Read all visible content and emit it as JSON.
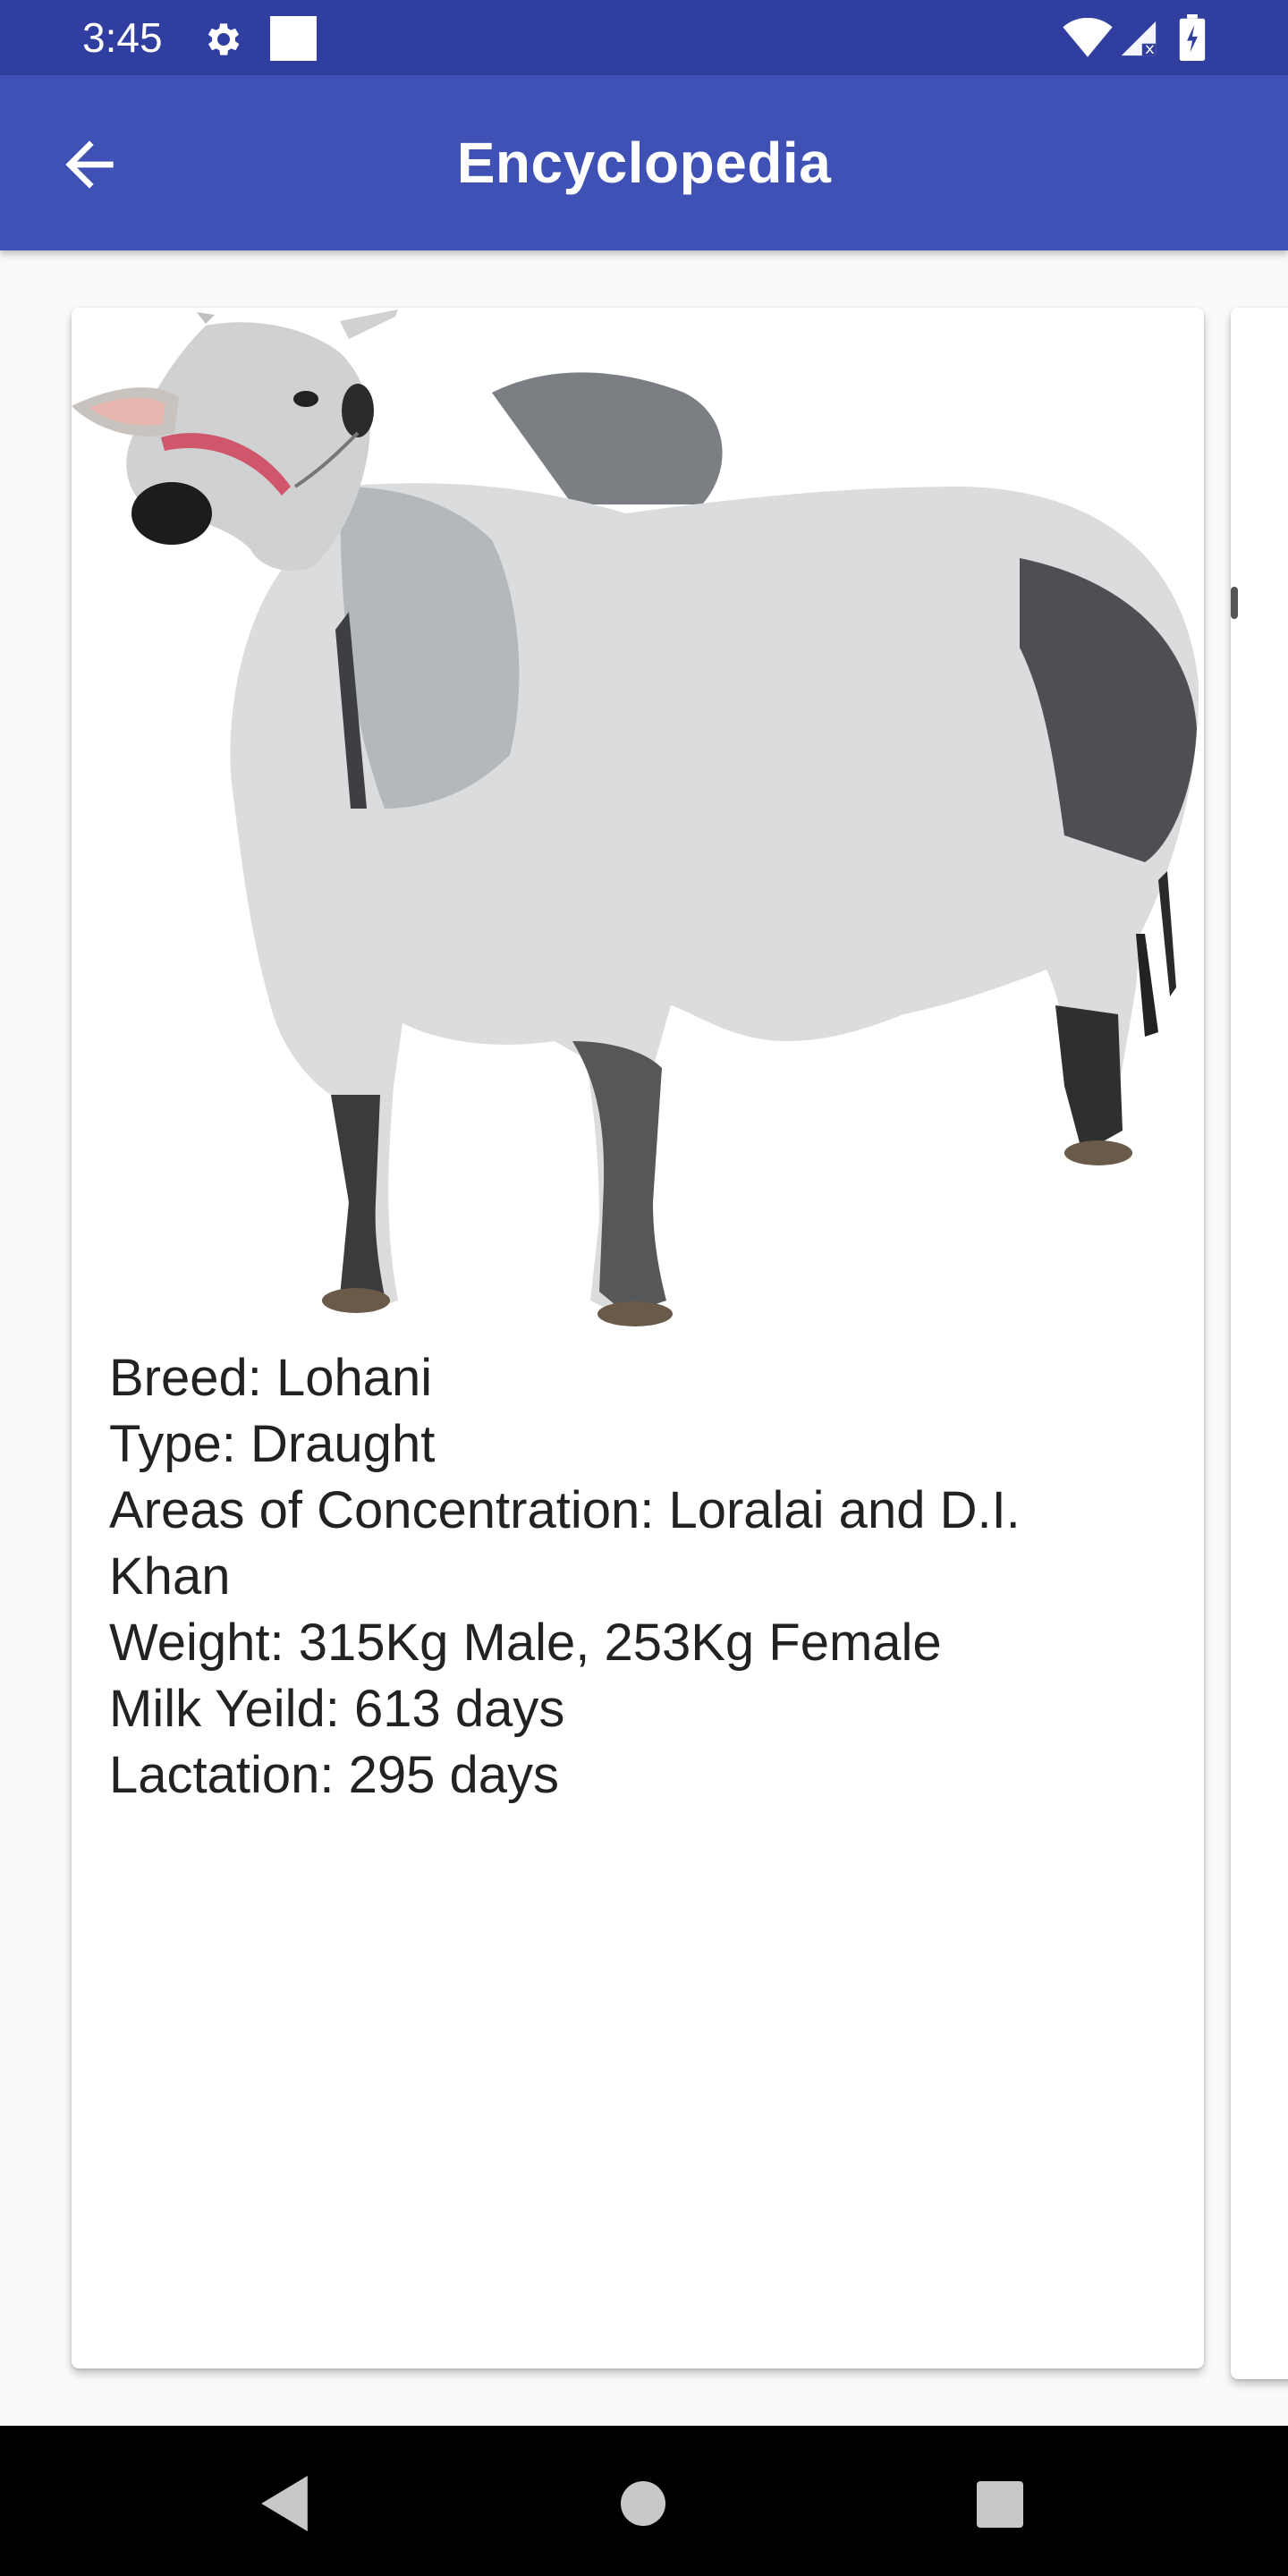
{
  "status_bar": {
    "time": "3:45",
    "icons": [
      "gear-icon",
      "notification-square-icon",
      "wifi-icon",
      "signal-icon",
      "battery-icon"
    ]
  },
  "app_bar": {
    "title": "Encyclopedia",
    "back_icon": "arrow-left-icon",
    "color": "#3f51b5"
  },
  "card": {
    "image": "lohani-bull-photo",
    "details": [
      "Breed: Lohani",
      "Type: Draught",
      "Areas of Concentration: Loralai and D.I.",
      "Khan",
      "Weight: 315Kg Male, 253Kg Female",
      "Milk Yeild: 613 days",
      "Lactation: 295 days"
    ]
  },
  "nav_bar": {
    "icons": [
      "back-triangle-icon",
      "home-circle-icon",
      "recents-square-icon"
    ]
  }
}
